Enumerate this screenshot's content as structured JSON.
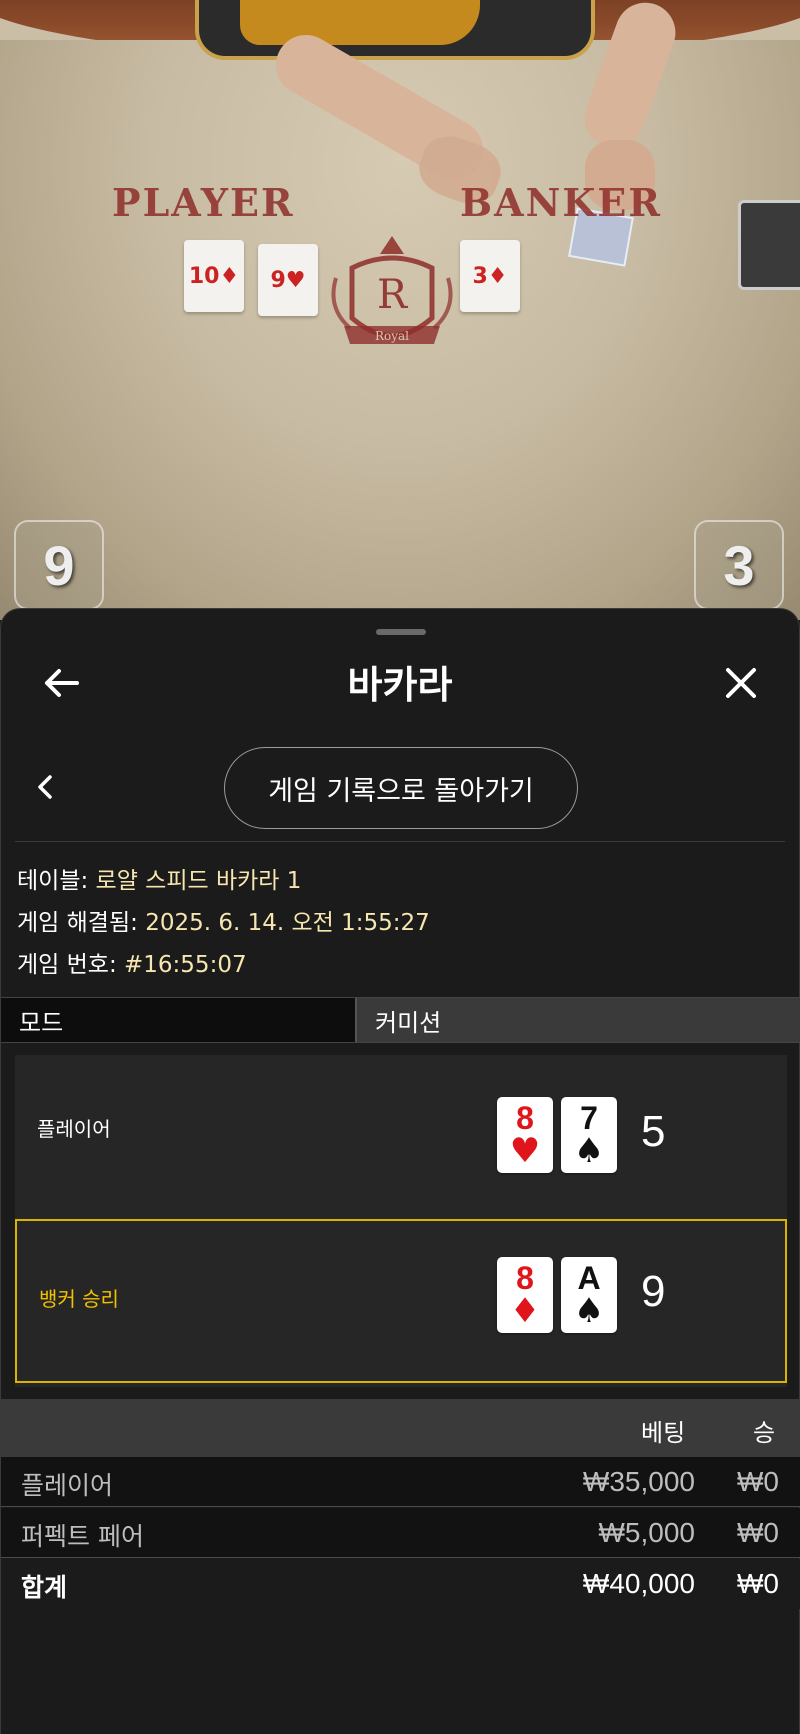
{
  "video": {
    "felt_labels": {
      "player": "PLAYER",
      "banker": "BANKER"
    },
    "crest_letter": "R",
    "crest_text": "Royal",
    "player_score": "9",
    "banker_score": "3",
    "felt_cards": [
      {
        "rank": "10",
        "suit": "♦"
      },
      {
        "rank": "9",
        "suit": "♥"
      },
      {
        "rank": "3",
        "suit": "♦"
      }
    ]
  },
  "sheet": {
    "title": "바카라",
    "back_icon": "arrow-left-icon",
    "close_icon": "close-icon",
    "history_button": "게임 기록으로 돌아가기",
    "meta": {
      "table_label": "테이블:",
      "table_value": "로얄 스피드 바카라 1",
      "resolved_label": "게임 해결됨:",
      "resolved_value": "2025. 6. 14. 오전 1:55:27",
      "game_no_label": "게임 번호:",
      "game_no_value": "#16:55:07"
    },
    "mode_tabs": [
      {
        "label": "모드",
        "active": true
      },
      {
        "label": "커미션",
        "active": false
      }
    ],
    "outcomes": {
      "player": {
        "label": "플레이어",
        "cards": [
          {
            "rank": "8",
            "suit": "♥",
            "color": "red"
          },
          {
            "rank": "7",
            "suit": "♠",
            "color": "black"
          }
        ],
        "score": "5"
      },
      "banker": {
        "label": "뱅커 승리",
        "winner": true,
        "cards": [
          {
            "rank": "8",
            "suit": "♦",
            "color": "red"
          },
          {
            "rank": "A",
            "suit": "♠",
            "color": "black"
          }
        ],
        "score": "9"
      }
    },
    "bets": {
      "headers": {
        "bet": "베팅",
        "win": "승"
      },
      "rows": [
        {
          "name": "플레이어",
          "bet": "₩35,000",
          "win": "₩0"
        },
        {
          "name": "퍼펙트 페어",
          "bet": "₩5,000",
          "win": "₩0"
        }
      ],
      "total": {
        "name": "합계",
        "bet": "₩40,000",
        "win": "₩0"
      }
    }
  },
  "colors": {
    "accent_gold": "#d9b300",
    "meta_value": "#f7e6b0",
    "card_red": "#e0151b",
    "felt_text": "#8e2e2a"
  }
}
